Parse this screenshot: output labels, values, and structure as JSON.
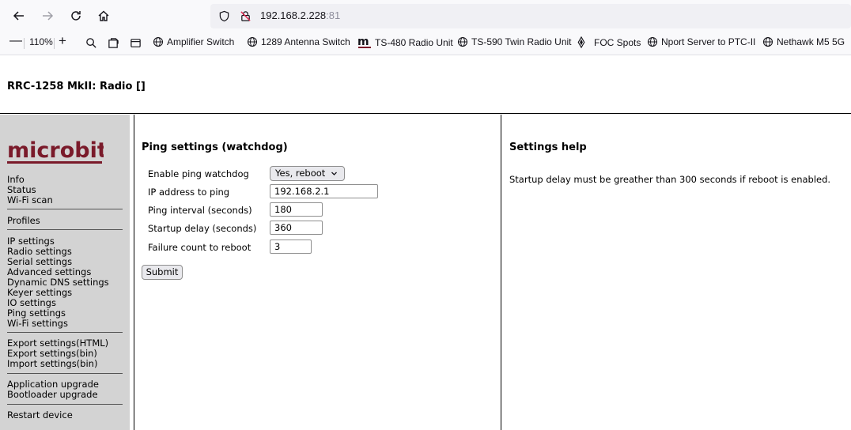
{
  "browser": {
    "url_host": "192.168.2.228",
    "url_port": ":81",
    "zoom": "110%",
    "bookmarks": [
      "Amplifier Switch",
      "1289 Antenna Switch",
      "TS-480 Radio Unit",
      "TS-590 Twin Radio Unit",
      "FOC Spots",
      "Nport Server to PTC-II",
      "Nethawk M5 5G"
    ]
  },
  "page": {
    "title": "RRC-1258 MkII: Radio []",
    "logo": "microbit"
  },
  "menu": {
    "group1": [
      "Info",
      "Status",
      "Wi-Fi scan"
    ],
    "group2": [
      "Profiles"
    ],
    "group3": [
      "IP settings",
      "Radio settings",
      "Serial settings",
      "Advanced settings",
      "Dynamic DNS settings",
      "Keyer settings",
      "IO settings",
      "Ping settings",
      "Wi-Fi settings"
    ],
    "group4": [
      "Export settings(HTML)",
      "Export settings(bin)",
      "Import settings(bin)"
    ],
    "group5": [
      "Application upgrade",
      "Bootloader upgrade"
    ],
    "group6": [
      "Restart device"
    ]
  },
  "form": {
    "heading": "Ping settings (watchdog)",
    "watchdog_label": "Enable ping watchdog",
    "watchdog_value": "Yes, reboot",
    "ip_label": "IP address to ping",
    "ip_value": "192.168.2.1",
    "interval_label": "Ping interval (seconds)",
    "interval_value": "180",
    "startup_label": "Startup delay (seconds)",
    "startup_value": "360",
    "failure_label": "Failure count to reboot",
    "failure_value": "3",
    "submit_label": "Submit"
  },
  "help": {
    "heading": "Settings help",
    "text": "Startup delay must be greather than 300 seconds if reboot is enabled."
  },
  "colors": {
    "logo": "#7a1a2a",
    "sidebar": "#d3d3d3"
  }
}
